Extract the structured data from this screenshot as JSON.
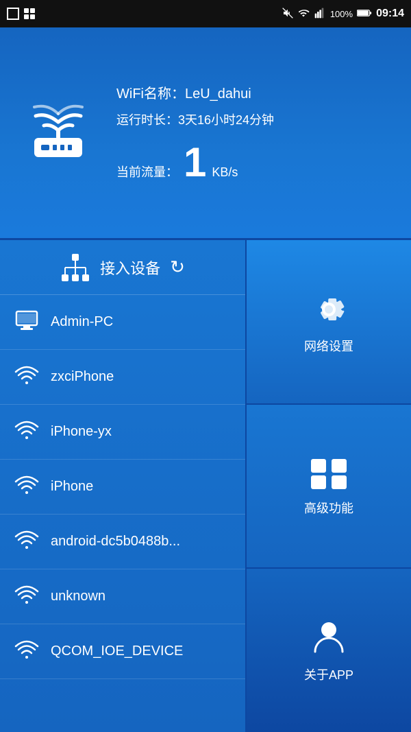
{
  "statusBar": {
    "time": "09:14",
    "battery": "100%",
    "icons": [
      "signal-icon",
      "wifi-icon",
      "battery-icon",
      "mute-icon"
    ]
  },
  "header": {
    "wifiLabel": "WiFi名称：LeU_dahui",
    "uptimeLabel": "运行时长：3天16小时24分钟",
    "trafficLabel": "当前流量：",
    "trafficValue": "1",
    "trafficUnit": "KB/s"
  },
  "devicePanel": {
    "title": "接入设备",
    "refreshIcon": "↻",
    "devices": [
      {
        "name": "Admin-PC",
        "type": "wired"
      },
      {
        "name": "zxciPhone",
        "type": "wifi"
      },
      {
        "name": "iPhone-yx",
        "type": "wifi"
      },
      {
        "name": "iPhone",
        "type": "wifi"
      },
      {
        "name": "android-dc5b0488b...",
        "type": "wifi"
      },
      {
        "name": "unknown",
        "type": "wifi"
      },
      {
        "name": "QCOM_IOE_DEVICE",
        "type": "wifi"
      }
    ]
  },
  "functionPanel": {
    "buttons": [
      {
        "id": "network-settings",
        "label": "网络设置"
      },
      {
        "id": "advanced-features",
        "label": "高级功能"
      },
      {
        "id": "about-app",
        "label": "关于APP"
      }
    ]
  }
}
